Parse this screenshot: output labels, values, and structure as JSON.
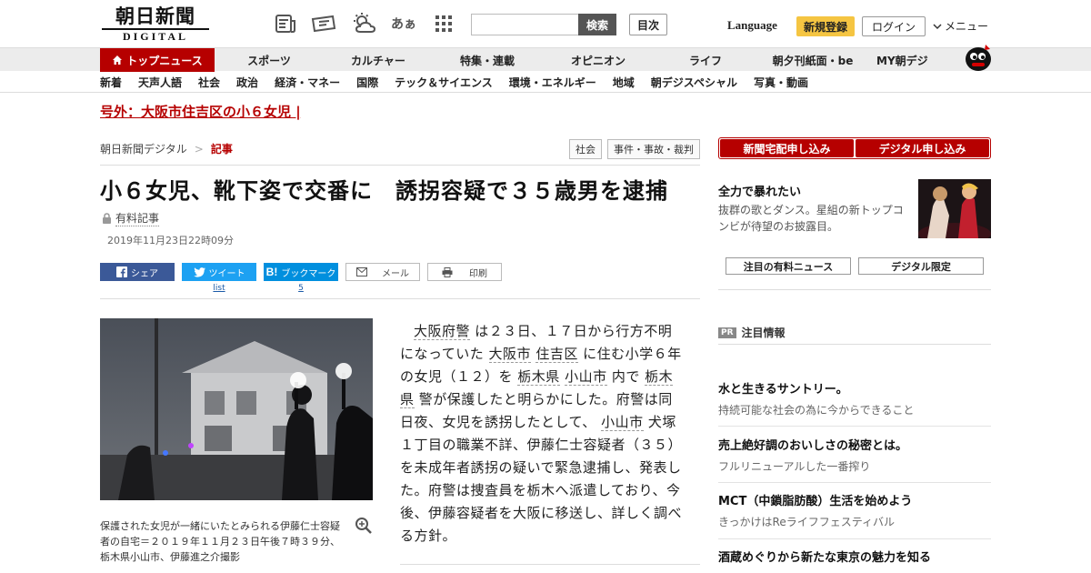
{
  "header": {
    "logo_main": "朝日新聞",
    "logo_sub": "DIGITAL",
    "search_button": "検索",
    "search_placeholder": "",
    "toc_button": "目次",
    "language": "Language",
    "register": "新規登録",
    "login": "ログイン",
    "menu": "メニュー",
    "kana_icon": "あぁ",
    "icons": [
      "newspaper-icon",
      "ticket-icon",
      "weather-icon",
      "font-size-icon",
      "grid-icon"
    ]
  },
  "mainnav": {
    "items": [
      {
        "label": "トップニュース",
        "active": true
      },
      {
        "label": "スポーツ"
      },
      {
        "label": "カルチャー"
      },
      {
        "label": "特集・連載"
      },
      {
        "label": "オピニオン"
      },
      {
        "label": "ライフ"
      },
      {
        "label": "朝夕刊紙面・be"
      },
      {
        "label": "MY朝デジ"
      }
    ]
  },
  "subnav": {
    "items": [
      "新着",
      "天声人語",
      "社会",
      "政治",
      "経済・マネー",
      "国際",
      "テック＆サイエンス",
      "環境・エネルギー",
      "地域",
      "朝デジスペシャル",
      "写真・動画"
    ]
  },
  "breaking": "号外：大阪市住吉区の小６女児 |",
  "breadcrumb": {
    "home": "朝日新聞デジタル",
    "separator": ">",
    "current": "記事"
  },
  "tags": [
    "社会",
    "事件・事故・裁判"
  ],
  "article": {
    "title": "小６女児、靴下姿で交番に　誘拐容疑で３５歳男を逮捕",
    "premium_label": "有料記事",
    "date": "2019年11月23日22時09分",
    "body_parts": [
      {
        "text": "大阪府警",
        "link": true
      },
      {
        "text": " は２３日、１７日から行方不明になっていた "
      },
      {
        "text": "大阪市",
        "link": true
      },
      {
        "text": " "
      },
      {
        "text": "住吉区",
        "link": true
      },
      {
        "text": " に住む小学６年の女児（１２）を "
      },
      {
        "text": "栃木県",
        "link": true
      },
      {
        "text": " "
      },
      {
        "text": "小山市",
        "link": true
      },
      {
        "text": " 内で "
      },
      {
        "text": "栃木県",
        "link": true
      },
      {
        "text": " 警が保護したと明らかにした。府警は同日夜、女児を誘拐したとして、 "
      },
      {
        "text": "小山市",
        "link": true
      },
      {
        "text": " 犬塚１丁目の職業不詳、伊藤仁士容疑者（３５）を未成年者誘拐の疑いで緊急逮捕し、発表した。府警は捜査員を栃木へ派遣しており、今後、伊藤容疑者を大阪に移送し、詳しく調べる方針。"
      }
    ],
    "caption": "保護された女児が一緒にいたとみられる伊藤仁士容疑者の自宅＝２０１９年１１月２３日午後７時３９分、栃木県小山市、伊藤進之介撮影"
  },
  "share": {
    "facebook": "シェア",
    "twitter": "ツイート",
    "twitter_count": "list",
    "hatena": "ブックマーク",
    "hatena_count": "5",
    "mail": "メール",
    "print": "印刷"
  },
  "sidebar": {
    "cta_newspaper": "新聞宅配申し込み",
    "cta_digital": "デジタル申し込み",
    "promo_title": "全力で暴れたい",
    "promo_desc": "抜群の歌とダンス。星組の新トップコンビが待望のお披露目。",
    "tab_premium": "注目の有料ニュース",
    "tab_digital": "デジタル限定",
    "pr_badge": "PR",
    "pr_title": "注目情報",
    "ads": [
      {
        "title": "水と生きるサントリー。",
        "sub": "持続可能な社会の為に今からできること"
      },
      {
        "title": "売上絶好調のおいしさの秘密とは。",
        "sub": "フルリニューアルした一番搾り"
      },
      {
        "title": "MCT（中鎖脂肪酸）生活を始めよう",
        "sub": "きっかけはReライフフェスティバル"
      },
      {
        "title": "酒蔵めぐりから新たな東京の魅力を知る",
        "sub": ""
      }
    ]
  },
  "colors": {
    "brand_red": "#b60000",
    "register_yellow": "#f5c542",
    "facebook": "#3b5998",
    "twitter": "#1da1f2",
    "hatena": "#008fde"
  }
}
